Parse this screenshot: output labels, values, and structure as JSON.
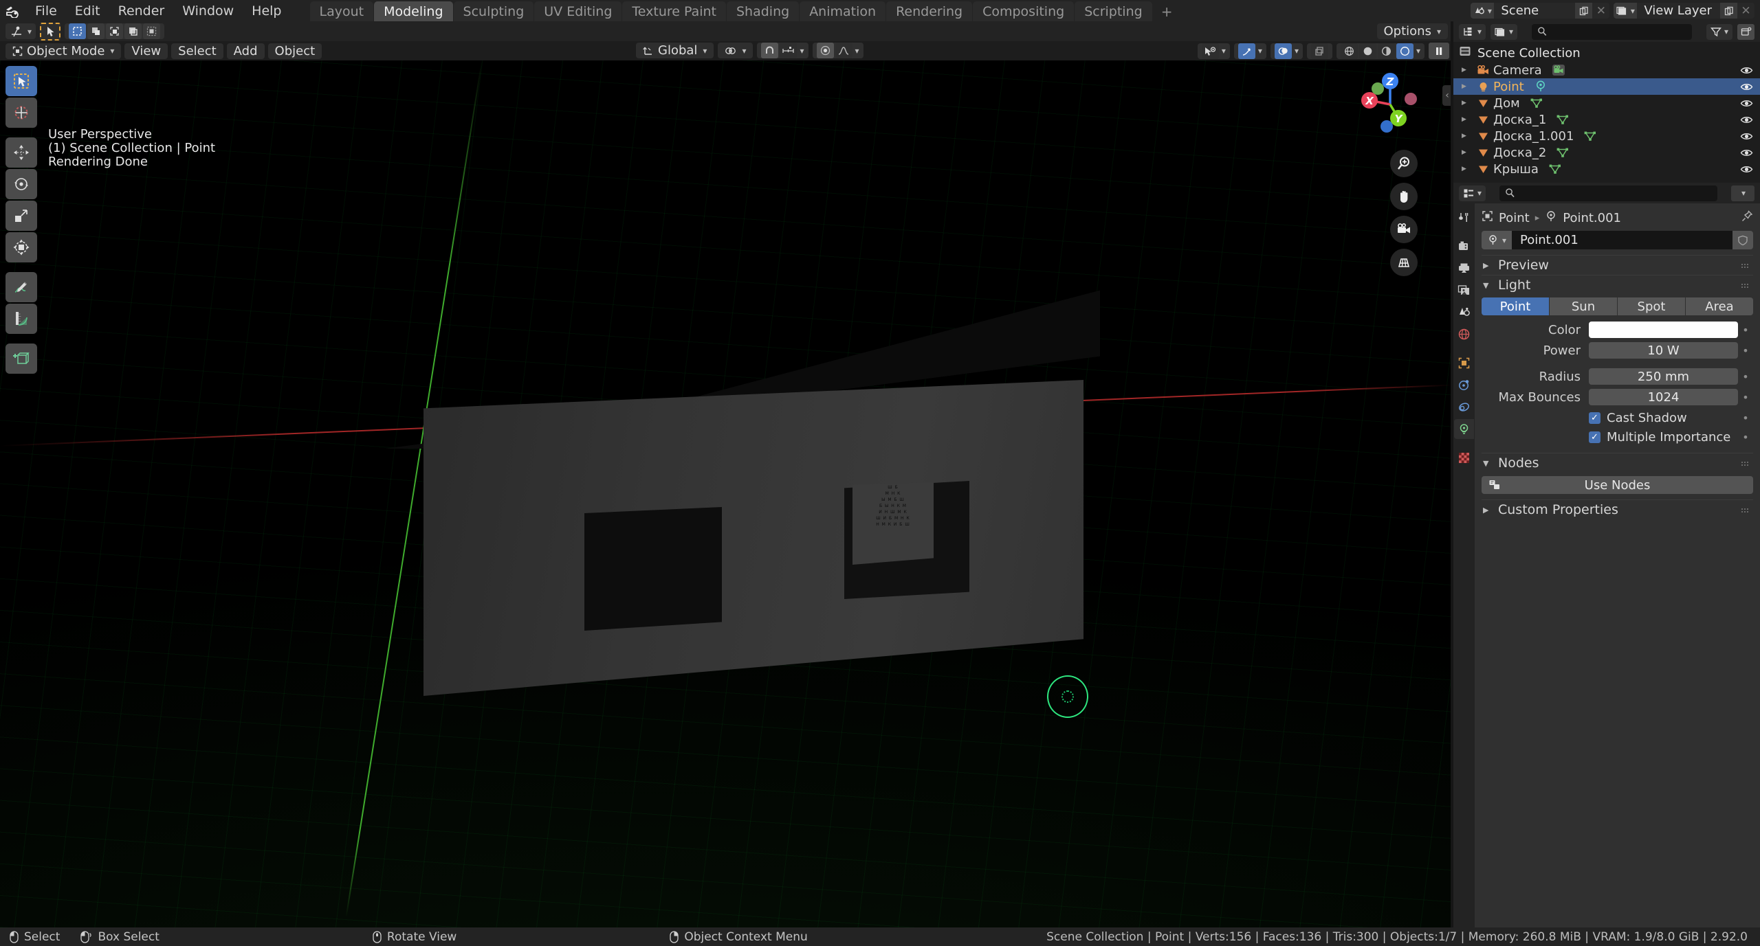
{
  "app": {
    "name": "Blender",
    "version": "2.92.0"
  },
  "topbar": {
    "logo_icon": "blender-logo-icon",
    "menus": [
      "File",
      "Edit",
      "Render",
      "Window",
      "Help"
    ],
    "workspace_tabs": [
      {
        "label": "Layout",
        "active": false
      },
      {
        "label": "Modeling",
        "active": true
      },
      {
        "label": "Sculpting",
        "active": false
      },
      {
        "label": "UV Editing",
        "active": false
      },
      {
        "label": "Texture Paint",
        "active": false
      },
      {
        "label": "Shading",
        "active": false
      },
      {
        "label": "Animation",
        "active": false
      },
      {
        "label": "Rendering",
        "active": false
      },
      {
        "label": "Compositing",
        "active": false
      },
      {
        "label": "Scripting",
        "active": false
      }
    ],
    "add_workspace_label": "+",
    "scene_selector": {
      "icon": "scene-icon",
      "value": "Scene",
      "new_icon": "copy-icon",
      "remove_icon": "x-icon"
    },
    "viewlayer_selector": {
      "icon": "view-layer-icon",
      "value": "View Layer",
      "new_icon": "copy-icon",
      "remove_icon": "x-icon"
    }
  },
  "viewport_tool_header": {
    "tool_settings_icon": "active-tool-icon",
    "cursor_tool_icon": "tweak-tool-icon",
    "select_modes": [
      "set-select-icon",
      "extend-select-icon",
      "subtract-select-icon",
      "invert-select-icon",
      "intersect-select-icon"
    ],
    "options_label": "Options"
  },
  "viewport_header": {
    "mode": "Object Mode",
    "menus": [
      "View",
      "Select",
      "Add",
      "Object"
    ],
    "transform_orientation": "Global",
    "pivot_icon": "pivot-point-icon",
    "snap_icon": "magnet-icon",
    "snap_target_icon": "snap-increment-icon",
    "proportional_icon": "proportional-editing-icon",
    "falloff_icon": "smooth-falloff-icon",
    "visibility_icon": "object-visibility-icon",
    "gizmo_icon": "gizmo-icon",
    "overlays_icon": "overlays-icon",
    "xray_icon": "xray-icon",
    "shading_modes": [
      "wireframe-icon",
      "solid-icon",
      "material-preview-icon",
      "rendered-icon"
    ],
    "shading_active": "rendered-icon",
    "pause_icon": "pause-render-icon"
  },
  "viewport": {
    "overlay_lines": [
      "User Perspective",
      "(1) Scene Collection | Point",
      "Rendering Done"
    ],
    "toolbar": [
      {
        "name": "tweak-tool",
        "active": true
      },
      {
        "name": "cursor-tool",
        "active": false
      },
      {
        "name": "move-tool",
        "active": false
      },
      {
        "name": "rotate-tool",
        "active": false
      },
      {
        "name": "scale-tool",
        "active": false
      },
      {
        "name": "transform-tool",
        "active": false
      },
      {
        "name": "annotate-tool",
        "active": false
      },
      {
        "name": "measure-tool",
        "active": false
      },
      {
        "name": "add-cube-tool",
        "active": false
      }
    ],
    "gizmo_axes": [
      {
        "label": "Z",
        "color": "#3c82f0"
      },
      {
        "label": "X",
        "color": "#e8425a"
      },
      {
        "label": "Y",
        "color": "#7ed321"
      }
    ],
    "nav_buttons": [
      "zoom-icon",
      "pan-hand-icon",
      "camera-view-icon",
      "toggle-perspective-icon"
    ],
    "scene_objects": {
      "eye_chart_rows": [
        "Ш Б",
        "М Н К",
        "Ы М Б Ш",
        "Б Ы Н К М",
        "И Н Ш М К",
        "Ш И Б М Н К",
        "Н М К И Б Ш"
      ]
    }
  },
  "outliner": {
    "display_mode_icon": "outliner-icon",
    "filter_type_icon": "view-layer-icon",
    "search_placeholder": "",
    "filter_icon": "filter-funnel-icon",
    "new_collection_icon": "new-collection-icon",
    "root": {
      "label": "Scene Collection",
      "icon": "collection-icon"
    },
    "items": [
      {
        "label": "Camera",
        "icon": "camera-object-icon",
        "data_icon": "camera-data-icon",
        "selected": false,
        "visible": true
      },
      {
        "label": "Point",
        "icon": "light-object-icon",
        "data_icon": "point-light-data-icon",
        "selected": true,
        "visible": true
      },
      {
        "label": "Дом",
        "icon": "mesh-object-icon",
        "data_icon": "mesh-data-icon",
        "selected": false,
        "visible": true
      },
      {
        "label": "Доска_1",
        "icon": "mesh-object-icon",
        "data_icon": "mesh-data-icon",
        "selected": false,
        "visible": true
      },
      {
        "label": "Доска_1.001",
        "icon": "mesh-object-icon",
        "data_icon": "mesh-data-icon",
        "selected": false,
        "visible": true
      },
      {
        "label": "Доска_2",
        "icon": "mesh-object-icon",
        "data_icon": "mesh-data-icon",
        "selected": false,
        "visible": true
      },
      {
        "label": "Крыша",
        "icon": "mesh-object-icon",
        "data_icon": "mesh-data-icon",
        "selected": false,
        "visible": true
      }
    ]
  },
  "properties": {
    "editor_type_icon": "properties-editor-icon",
    "search_placeholder": "",
    "options_caret_icon": "chevron-down-icon",
    "tabs": [
      {
        "name": "tool-tab",
        "icon": "tool-icon",
        "active": false
      },
      {
        "name": "render-tab",
        "icon": "render-camera-icon",
        "active": false
      },
      {
        "name": "output-tab",
        "icon": "printer-icon",
        "active": false
      },
      {
        "name": "view-layer-tab",
        "icon": "images-icon",
        "active": false
      },
      {
        "name": "scene-tab",
        "icon": "scene-cone-icon",
        "active": false
      },
      {
        "name": "world-tab",
        "icon": "world-globe-icon",
        "active": false
      },
      {
        "name": "object-tab",
        "icon": "object-square-icon",
        "active": false
      },
      {
        "name": "modifier-tab",
        "icon": "physics-orbit-icon",
        "active": false
      },
      {
        "name": "constraints-tab",
        "icon": "constraint-icon",
        "active": false
      },
      {
        "name": "data-tab",
        "icon": "light-bulb-icon",
        "active": true
      },
      {
        "name": "material-tab",
        "icon": "checker-material-icon",
        "active": false
      }
    ],
    "breadcrumb": {
      "object_icon": "object-square-icon",
      "object_name": "Point",
      "separator": "▸",
      "data_icon": "point-light-data-icon",
      "data_name": "Point.001",
      "pin_icon": "pin-icon"
    },
    "id_block": {
      "icon": "point-light-data-icon",
      "caret": "chevron-down-icon",
      "name": "Point.001",
      "fake_user_icon": "shield-icon"
    },
    "panels": {
      "preview": {
        "label": "Preview",
        "open": false
      },
      "light": {
        "label": "Light",
        "open": true,
        "types": [
          {
            "label": "Point",
            "active": true
          },
          {
            "label": "Sun",
            "active": false
          },
          {
            "label": "Spot",
            "active": false
          },
          {
            "label": "Area",
            "active": false
          }
        ],
        "fields": [
          {
            "label": "Color",
            "value": "",
            "kind": "color",
            "color": "#ffffff"
          },
          {
            "label": "Power",
            "value": "10 W",
            "kind": "value"
          },
          {
            "label": "Radius",
            "value": "250 mm",
            "kind": "value"
          },
          {
            "label": "Max Bounces",
            "value": "1024",
            "kind": "value"
          }
        ],
        "checkboxes": [
          {
            "label": "Cast Shadow",
            "checked": true
          },
          {
            "label": "Multiple Importance",
            "checked": true
          }
        ]
      },
      "nodes": {
        "label": "Nodes",
        "open": true,
        "use_nodes_label": "Use Nodes",
        "use_nodes_icon": "nodetree-icon"
      },
      "custom_properties": {
        "label": "Custom Properties",
        "open": false
      }
    }
  },
  "statusbar": {
    "keymap": [
      {
        "icon": "mouse-left-icon",
        "label": "Select"
      },
      {
        "icon": "mouse-left-drag-icon",
        "label": "Box Select"
      },
      {
        "icon": "mouse-middle-icon",
        "label": "Rotate View"
      },
      {
        "icon": "mouse-right-icon",
        "label": "Object Context Menu"
      }
    ],
    "stats": "Scene Collection | Point | Verts:156 | Faces:136 | Tris:300 | Objects:1/7 | Memory: 260.8 MiB | VRAM: 1.9/8.0 GiB | 2.92.0"
  },
  "colors": {
    "accent_blue": "#4772b3",
    "selection_row": "#3a5a8c",
    "selected_text": "#f3b55a",
    "header_bg": "#232323",
    "panel_bg": "#303030",
    "editor_bg": "#1d1d1d"
  }
}
